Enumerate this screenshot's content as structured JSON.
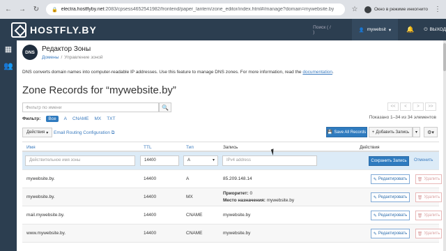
{
  "browser": {
    "url_host": "electra.hostflyby.net",
    "url_rest": ":2083/cpsess4652541982/frontend/paper_lantern/zone_editor/index.html#/manage?domain=mywebsite.by",
    "incognito_label": "Окно в режиме инкогнито"
  },
  "header": {
    "logo_text": "HOSTFLY.BY",
    "search_label": "Поиск ( / )",
    "user_label": "mywebsit",
    "logout_label": "ВЫХОД"
  },
  "page": {
    "icon_text": "DNS",
    "title": "Редактор Зоны",
    "breadcrumb_home": "Домены",
    "breadcrumb_sep": "/",
    "breadcrumb_current": "Управление зоной",
    "description": "DNS converts domain names into computer-readable IP addresses. Use this feature to manage DNS zones. For more information, read the ",
    "description_link": "documentation",
    "description_end": ".",
    "zone_title": "Zone Records for “mywebsite.by”"
  },
  "filter": {
    "placeholder": "Фильтр по имени",
    "label": "Фильтр:",
    "types": [
      "Все",
      "A",
      "CNAME",
      "MX",
      "TXT"
    ],
    "active_type": "Все"
  },
  "pager": {
    "buttons": [
      "<<",
      "<",
      ">",
      ">>"
    ],
    "shown_text": "Показано 1–34 из 34 элементов"
  },
  "toolbar": {
    "actions_label": "Действия",
    "email_routing_label": "Email Routing Configuration",
    "save_all_label": "Save All Records",
    "add_record_label": "Добавить Запись"
  },
  "table": {
    "headers": {
      "name": "Имя",
      "ttl": "TTL",
      "type": "Тип",
      "record": "Запись",
      "actions": "Действия"
    },
    "editor": {
      "name_placeholder": "Действительное имя зоны",
      "ttl_value": "14400",
      "type_value": "A",
      "record_placeholder": "IPv4 address",
      "save_label": "Сохранить Запись",
      "cancel_label": "Отменить"
    },
    "edit_label": "Редактировать",
    "delete_label": "Удалить",
    "rows": [
      {
        "name": "mywebsite.by.",
        "ttl": "14400",
        "type": "A",
        "record": "85.209.148.14"
      },
      {
        "name": "mywebsite.by.",
        "ttl": "14400",
        "type": "MX",
        "priority_label": "Приоритет:",
        "priority": "0",
        "dest_label": "Место назначения:",
        "dest": "mywebsite.by"
      },
      {
        "name": "mail.mywebsite.by.",
        "ttl": "14400",
        "type": "CNAME",
        "record": "mywebsite.by"
      },
      {
        "name": "www.mywebsite.by.",
        "ttl": "14400",
        "type": "CNAME",
        "record": "mywebsite.by"
      }
    ]
  },
  "colors": {
    "header_bg": "#2c3e50",
    "primary": "#2f7bbf",
    "editor_row": "#dcebf7",
    "link": "#3b7bbf"
  }
}
